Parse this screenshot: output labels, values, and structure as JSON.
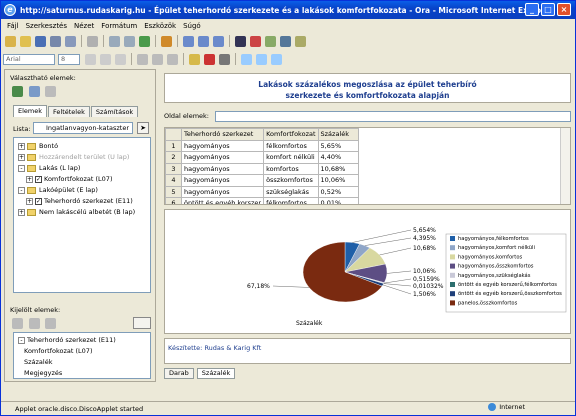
{
  "window": {
    "title": "http://saturnus.rudaskarig.hu - Épület teherhordó szerkezete és a lakások komfortfokozata - Ora - Microsoft Internet Explorer"
  },
  "menu": [
    "Fájl",
    "Szerkesztés",
    "Nézet",
    "Formátum",
    "Eszközök",
    "Súgó"
  ],
  "toolbar": {
    "font_value": "Arial",
    "size_value": "8"
  },
  "left": {
    "available_label": "Választható elemek:",
    "tabs": [
      "Elemek",
      "Feltételek",
      "Számítások"
    ],
    "list_label": "Lista:",
    "list_value": "Ingatlanvagyon-kataszter",
    "tree": [
      {
        "label": "Bontó",
        "level": 0,
        "exp": "+"
      },
      {
        "label": "Hozzárendelt terület (U lap)",
        "level": 0,
        "exp": "+",
        "dim": true
      },
      {
        "label": "Lakás (L lap)",
        "level": 0,
        "exp": "-"
      },
      {
        "label": "Komfortfokozat (L07)",
        "level": 1,
        "exp": "+",
        "check": true
      },
      {
        "label": "Lakóépület (E lap)",
        "level": 0,
        "exp": "-"
      },
      {
        "label": "Teherhordó szerkezet (E11)",
        "level": 1,
        "exp": "+",
        "check": true
      },
      {
        "label": "Nem lakáscélú albetét (B lap)",
        "level": 0,
        "exp": "+"
      }
    ],
    "selected_label": "Kijelölt elemek:",
    "selected": [
      "Teherhordó szerkezet (E11)",
      "Komfortfokozat (L07)",
      "Százalék",
      "Megjegyzés"
    ]
  },
  "report": {
    "title_line1": "Lakások százalékos megoszlása az épület teherbíró",
    "title_line2": "szerkezete és komfortfokozata alapján",
    "page_items_label": "Oldal elemek:",
    "headers": [
      "Teherhordó szerkezet",
      "Komfortfokozat",
      "Százalék"
    ],
    "rows": [
      [
        "1",
        "hagyományos",
        "félkomfortos",
        "5,65%"
      ],
      [
        "2",
        "hagyományos",
        "komfort nélküli",
        "4,40%"
      ],
      [
        "3",
        "hagyományos",
        "komfortos",
        "10,68%"
      ],
      [
        "4",
        "hagyományos",
        "összkomfortos",
        "10,06%"
      ],
      [
        "5",
        "hagyományos",
        "szükséglakás",
        "0,52%"
      ],
      [
        "6",
        "öntött és egyéb korszer",
        "félkomfortos",
        "0,01%"
      ]
    ],
    "footer": "Készítette: Rudas & Karig Kft",
    "bottom_tabs": [
      "Darab",
      "Százalék"
    ]
  },
  "chart_data": {
    "type": "pie",
    "xlabel": "Százalék",
    "categories": [
      "hagyományos,félkomfortos",
      "hagyományos,komfort nélküli",
      "hagyományos,komfortos",
      "hagyományos,összkomfortos",
      "hagyományos,szükséglakás",
      "öntött és egyéb korszerű,félkomfortos",
      "öntött és egyéb korszerű,összkomfortos",
      "panelos,összkomfortos"
    ],
    "values": [
      5.654,
      4.395,
      10.68,
      10.06,
      0.5159,
      0.01032,
      1.506,
      67.18
    ],
    "value_labels": [
      "5,654%",
      "4,395%",
      "10,68%",
      "10,06%",
      "0,5159%",
      "0,01032%",
      "1,506%",
      "67,18%"
    ],
    "colors": [
      "#1f5fa8",
      "#8fa6c8",
      "#d8d8a0",
      "#5d4e84",
      "#c9c9d8",
      "#2c6e6e",
      "#1e3f7a",
      "#7a2a10"
    ],
    "legend_position": "right"
  },
  "status": {
    "text": "Applet oracle.disco.DiscoApplet started",
    "zone": "Internet"
  }
}
